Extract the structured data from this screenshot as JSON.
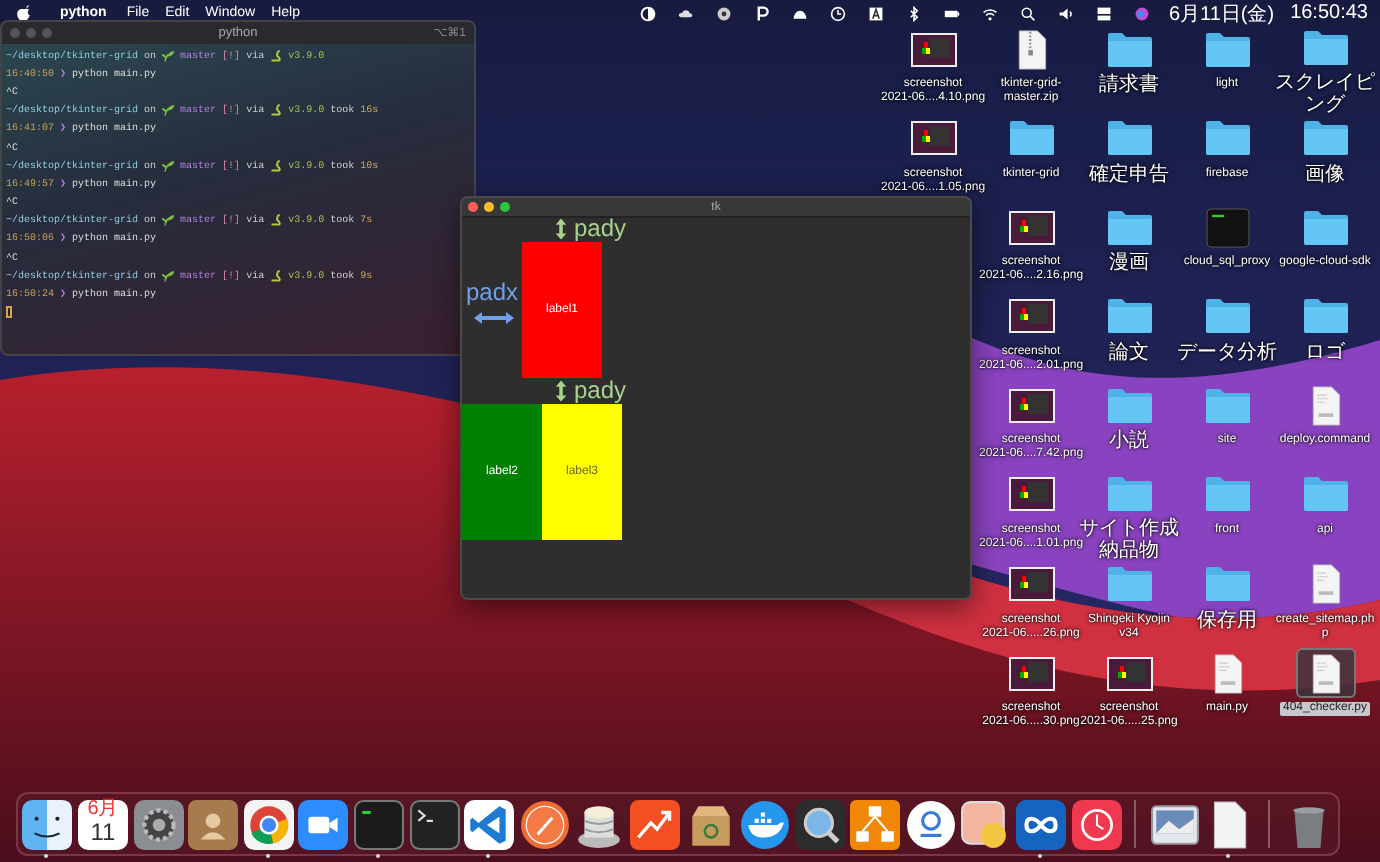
{
  "menu_bar": {
    "app_name": "python",
    "menus": [
      "File",
      "Edit",
      "Window",
      "Help"
    ],
    "date": "6月11日(金)",
    "time": "16:50:43"
  },
  "terminal": {
    "title": "python",
    "shortcut": "⌥⌘1",
    "cursor": true,
    "blocks": [
      {
        "path": "~/desktop/tkinter-grid",
        "on": "on",
        "branch": "master",
        "status": "[!]",
        "via": "via",
        "version": "v3.9.0",
        "time": "16:40:50",
        "prompt": "❯",
        "command": "python main.py",
        "interrupt": "^C"
      },
      {
        "path": "~/desktop/tkinter-grid",
        "on": "on",
        "branch": "master",
        "status": "[!]",
        "via": "via",
        "version": "v3.9.0",
        "took": "took",
        "duration": "16s",
        "time": "16:41:07",
        "prompt": "❯",
        "command": "python main.py",
        "interrupt": "^C"
      },
      {
        "path": "~/desktop/tkinter-grid",
        "on": "on",
        "branch": "master",
        "status": "[!]",
        "via": "via",
        "version": "v3.9.0",
        "took": "took",
        "duration": "10s",
        "time": "16:49:57",
        "prompt": "❯",
        "command": "python main.py",
        "interrupt": "^C"
      },
      {
        "path": "~/desktop/tkinter-grid",
        "on": "on",
        "branch": "master",
        "status": "[!]",
        "via": "via",
        "version": "v3.9.0",
        "took": "took",
        "duration": "7s",
        "time": "16:50:06",
        "prompt": "❯",
        "command": "python main.py",
        "interrupt": "^C"
      },
      {
        "path": "~/desktop/tkinter-grid",
        "on": "on",
        "branch": "master",
        "status": "[!]",
        "via": "via",
        "version": "v3.9.0",
        "took": "took",
        "duration": "9s",
        "time": "16:50:24",
        "prompt": "❯",
        "command": "python main.py"
      }
    ]
  },
  "tk_window": {
    "title": "tk",
    "labels": [
      {
        "text": "label1",
        "color": "#ff0000"
      },
      {
        "text": "label2",
        "color": "#008000"
      },
      {
        "text": "label3",
        "color": "#ffff00"
      }
    ],
    "annotations": [
      {
        "kind": "vertical",
        "text": "pady",
        "color": "#a9d18e"
      },
      {
        "kind": "horizontal",
        "text": "padx",
        "color": "#6fa0e8"
      },
      {
        "kind": "vertical",
        "text": "pady",
        "color": "#a9d18e"
      }
    ]
  },
  "desktop": {
    "columns": [
      [
        {
          "kind": "screenshot",
          "lines": [
            "screenshot",
            "2021-06....4.10.png"
          ],
          "selected": false
        },
        {
          "kind": "screenshot",
          "lines": [
            "screenshot",
            "2021-06....1.05.png"
          ],
          "selected": false
        }
      ],
      [
        {
          "kind": "zip",
          "lines": [
            "tkinter-grid-",
            "master.zip"
          ],
          "selected": false
        },
        {
          "kind": "folder",
          "lines": [
            "tkinter-grid"
          ],
          "selected": false
        },
        {
          "kind": "screenshot",
          "lines": [
            "screenshot",
            "2021-06....2.16.png"
          ],
          "selected": false
        },
        {
          "kind": "screenshot",
          "lines": [
            "screenshot",
            "2021-06....2.01.png"
          ],
          "selected": false
        },
        {
          "kind": "screenshot",
          "lines": [
            "screenshot",
            "2021-06....7.42.png"
          ],
          "selected": false
        },
        {
          "kind": "screenshot",
          "lines": [
            "screenshot",
            "2021-06....1.01.png"
          ],
          "selected": false
        },
        {
          "kind": "screenshot",
          "lines": [
            "screenshot",
            "2021-06.....26.png"
          ],
          "selected": false
        },
        {
          "kind": "screenshot",
          "lines": [
            "screenshot",
            "2021-06.....30.png"
          ],
          "selected": false
        }
      ],
      [
        {
          "kind": "folder",
          "lines": [
            "請求書"
          ],
          "selected": false
        },
        {
          "kind": "folder",
          "lines": [
            "確定申告"
          ],
          "selected": false
        },
        {
          "kind": "folder",
          "lines": [
            "漫画"
          ],
          "selected": false
        },
        {
          "kind": "folder",
          "lines": [
            "論文"
          ],
          "selected": false
        },
        {
          "kind": "folder",
          "lines": [
            "小説"
          ],
          "selected": false
        },
        {
          "kind": "folder",
          "lines": [
            "サイト作成納品物"
          ],
          "selected": false
        },
        {
          "kind": "folder",
          "lines": [
            "Shingeki Kyojin",
            "v34"
          ],
          "selected": false
        },
        {
          "kind": "screenshot",
          "lines": [
            "screenshot",
            "2021-06.....25.png"
          ],
          "selected": false
        }
      ],
      [
        {
          "kind": "folder",
          "lines": [
            "light"
          ],
          "selected": false
        },
        {
          "kind": "folder",
          "lines": [
            "firebase"
          ],
          "selected": false
        },
        {
          "kind": "terminal",
          "lines": [
            "cloud_sql_proxy"
          ],
          "selected": false
        },
        {
          "kind": "folder",
          "lines": [
            "データ分析"
          ],
          "selected": false
        },
        {
          "kind": "folder",
          "lines": [
            "site"
          ],
          "selected": false
        },
        {
          "kind": "folder",
          "lines": [
            "front"
          ],
          "selected": false
        },
        {
          "kind": "folder",
          "lines": [
            "保存用"
          ],
          "selected": false
        },
        {
          "kind": "document",
          "lines": [
            "main.py"
          ],
          "selected": false
        }
      ],
      [
        {
          "kind": "folder",
          "lines": [
            "スクレイピング"
          ],
          "selected": false
        },
        {
          "kind": "folder",
          "lines": [
            "画像"
          ],
          "selected": false
        },
        {
          "kind": "folder",
          "lines": [
            "google-cloud-sdk"
          ],
          "selected": false
        },
        {
          "kind": "folder",
          "lines": [
            "ロゴ"
          ],
          "selected": false
        },
        {
          "kind": "document",
          "lines": [
            "deploy.command"
          ],
          "selected": false
        },
        {
          "kind": "folder",
          "lines": [
            "api"
          ],
          "selected": false
        },
        {
          "kind": "document",
          "lines": [
            "create_sitemap.ph",
            "p"
          ],
          "selected": false
        },
        {
          "kind": "document",
          "lines": [
            "404_checker.py"
          ],
          "selected": true
        }
      ]
    ]
  },
  "dock": {
    "items": [
      {
        "kind": "finder",
        "running": true
      },
      {
        "kind": "calendar",
        "month": "6月",
        "day": "11",
        "running": false
      },
      {
        "kind": "settings",
        "running": false
      },
      {
        "kind": "contacts",
        "running": false
      },
      {
        "kind": "browser",
        "running": true
      },
      {
        "kind": "video",
        "running": false
      },
      {
        "kind": "terminal",
        "running": true
      },
      {
        "kind": "console",
        "running": false
      },
      {
        "kind": "editor",
        "running": true
      },
      {
        "kind": "rocket",
        "running": false
      },
      {
        "kind": "database",
        "running": false
      },
      {
        "kind": "chart",
        "running": false
      },
      {
        "kind": "box",
        "running": false
      },
      {
        "kind": "whale",
        "running": false
      },
      {
        "kind": "magnifier",
        "running": false
      },
      {
        "kind": "diagram",
        "running": false
      },
      {
        "kind": "person",
        "running": false
      },
      {
        "kind": "squares",
        "running": false
      },
      {
        "kind": "infinity",
        "running": true
      },
      {
        "kind": "clock",
        "running": false
      },
      {
        "kind": "divider"
      },
      {
        "kind": "image",
        "running": false
      },
      {
        "kind": "document",
        "running": true
      },
      {
        "kind": "divider"
      },
      {
        "kind": "trash",
        "running": false
      }
    ]
  }
}
